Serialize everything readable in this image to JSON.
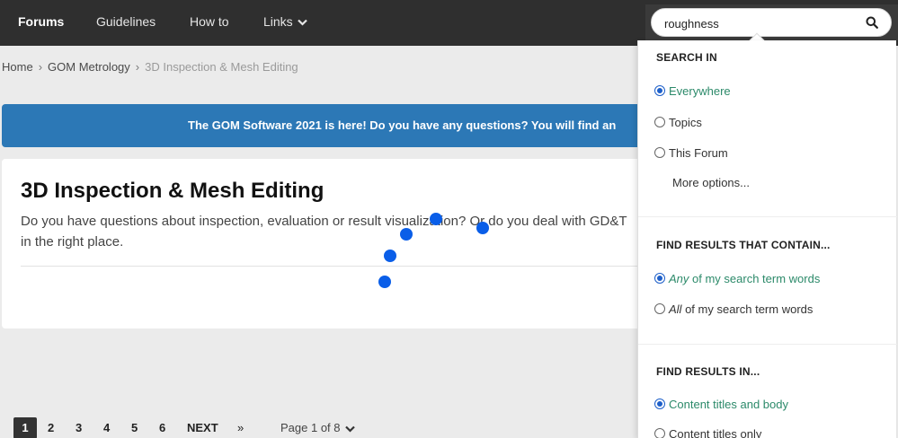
{
  "nav": {
    "items": [
      {
        "label": "Forums",
        "active": true
      },
      {
        "label": "Guidelines",
        "active": false
      },
      {
        "label": "How to",
        "active": false
      },
      {
        "label": "Links",
        "active": false,
        "has_dropdown": true
      }
    ]
  },
  "search": {
    "value": "roughness",
    "icon": "search-icon"
  },
  "breadcrumb": {
    "items": [
      "Home",
      "GOM Metrology",
      "3D Inspection & Mesh Editing"
    ]
  },
  "banner": {
    "text": "The GOM Software 2021 is here! Do you have any questions? You will find an"
  },
  "forum": {
    "title": "3D Inspection & Mesh Editing",
    "description": "Do you have questions about inspection, evaluation or result visualization? Or do you deal with GD&T",
    "description_line2": "in the right place."
  },
  "pagination": {
    "pages": [
      "1",
      "2",
      "3",
      "4",
      "5",
      "6"
    ],
    "current": "1",
    "next_label": "NEXT",
    "last_label": "»",
    "jump_label": "Page 1 of 8"
  },
  "search_panel": {
    "search_in": {
      "heading": "SEARCH IN",
      "options": [
        {
          "label": "Everywhere",
          "selected": true
        },
        {
          "label": "Topics",
          "selected": false
        },
        {
          "label": "This Forum",
          "selected": false
        }
      ],
      "more_options": "More options..."
    },
    "contain": {
      "heading": "FIND RESULTS THAT CONTAIN...",
      "options": [
        {
          "emph": "Any",
          "rest": " of my search term words",
          "selected": true
        },
        {
          "emph": "All",
          "rest": " of my search term words",
          "selected": false
        }
      ]
    },
    "results_in": {
      "heading": "FIND RESULTS IN...",
      "options": [
        {
          "label": "Content titles and body",
          "selected": true
        },
        {
          "label": "Content titles only",
          "selected": false
        }
      ]
    }
  },
  "colors": {
    "topbar": "#2f2f2f",
    "banner": "#2c78b6",
    "selected_option": "#2c8a6a",
    "radio_on": "#1d5fc9",
    "overlay_dot": "#0a5ee8"
  }
}
